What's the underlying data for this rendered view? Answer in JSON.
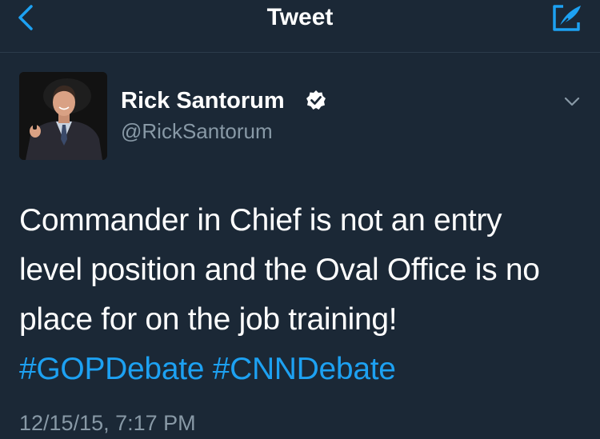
{
  "header": {
    "title": "Tweet",
    "back_icon": "chevron-left-icon",
    "compose_icon": "compose-tweet-icon"
  },
  "tweet": {
    "author": {
      "name": "Rick Santorum",
      "handle": "@RickSantorum",
      "verified": true,
      "avatar_icon": "user-avatar"
    },
    "text_lines": [
      "Commander in Chief is not an entry",
      "level position and the Oval Office is no",
      "place for on the job training!"
    ],
    "hashtags": [
      "#GOPDebate",
      "#CNNDebate"
    ],
    "timestamp": "12/15/15, 7:17 PM",
    "menu_icon": "chevron-down-icon"
  },
  "colors": {
    "background": "#1b2836",
    "accent": "#1da1f2",
    "secondary_text": "#8899a6",
    "primary_text": "#ffffff"
  }
}
